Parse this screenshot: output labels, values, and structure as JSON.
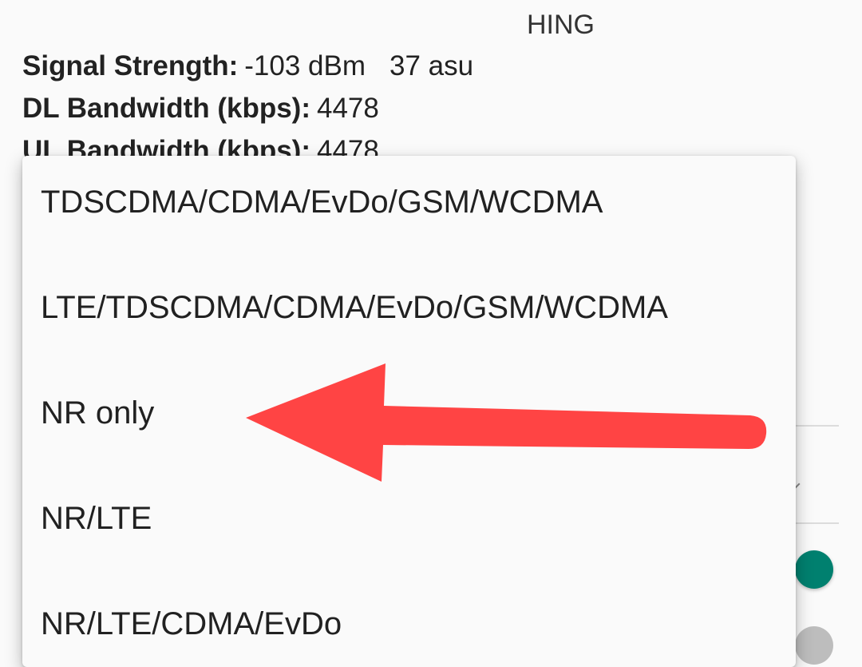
{
  "radio_info": {
    "top_fragment": "HING",
    "signal_strength": {
      "label": "Signal Strength:",
      "dbm": "-103 dBm",
      "asu": "37 asu"
    },
    "dl_bandwidth": {
      "label": "DL Bandwidth (kbps):",
      "value": "4478"
    },
    "ul_bandwidth": {
      "label": "UL Bandwidth (kbps):",
      "value": "4478"
    }
  },
  "network_type_menu": {
    "options": [
      "TDSCDMA/CDMA/EvDo/GSM/WCDMA",
      "LTE/TDSCDMA/CDMA/EvDo/GSM/WCDMA",
      "NR only",
      "NR/LTE",
      "NR/LTE/CDMA/EvDo"
    ]
  },
  "annotation": {
    "type": "arrow",
    "points_to": "NR only",
    "color": "#ff4444"
  },
  "colors": {
    "toggle_on": "#00806f",
    "toggle_off": "#bdbdbd",
    "background": "#fafafa"
  }
}
